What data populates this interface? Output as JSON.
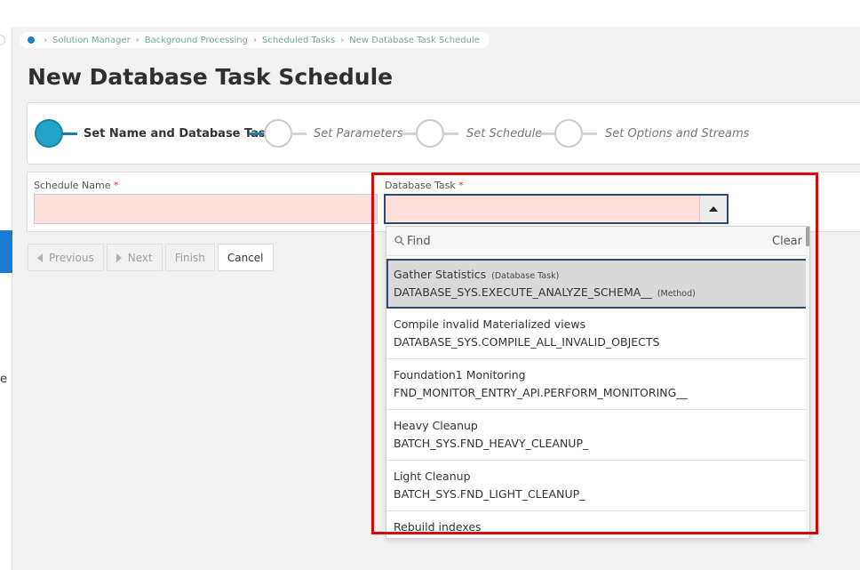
{
  "breadcrumb": {
    "items": [
      "Solution Manager",
      "Background Processing",
      "Scheduled Tasks",
      "New Database Task Schedule"
    ]
  },
  "page": {
    "title": "New Database Task Schedule"
  },
  "stepper": {
    "steps": [
      {
        "label": "Set Name and Database Task",
        "state": "active"
      },
      {
        "label": "Set Parameters",
        "state": "inactive"
      },
      {
        "label": "Set Schedule",
        "state": "inactive"
      },
      {
        "label": "Set Options and Streams",
        "state": "inactive"
      }
    ]
  },
  "form": {
    "schedule_name_label": "Schedule Name",
    "database_task_label": "Database Task",
    "required_marker": "*",
    "schedule_name_value": "",
    "database_task_value": ""
  },
  "buttons": {
    "previous": "Previous",
    "next": "Next",
    "finish": "Finish",
    "cancel": "Cancel"
  },
  "dropdown": {
    "find_placeholder": "Find",
    "clear_label": "Clear",
    "items": [
      {
        "name": "Gather Statistics",
        "name_tag": "(Database Task)",
        "method": "DATABASE_SYS.EXECUTE_ANALYZE_SCHEMA__",
        "method_tag": "(Method)",
        "selected": true
      },
      {
        "name": "Compile invalid Materialized views",
        "method": "DATABASE_SYS.COMPILE_ALL_INVALID_OBJECTS"
      },
      {
        "name": "Foundation1 Monitoring",
        "method": "FND_MONITOR_ENTRY_API.PERFORM_MONITORING__"
      },
      {
        "name": "Heavy Cleanup",
        "method": "BATCH_SYS.FND_HEAVY_CLEANUP_"
      },
      {
        "name": "Light Cleanup",
        "method": "BATCH_SYS.FND_LIGHT_CLEANUP_"
      },
      {
        "name": "Rebuild indexes",
        "method": ""
      }
    ]
  },
  "leftnav": {
    "partial_letter": "e"
  },
  "colors": {
    "accent": "#22a4c8",
    "required_field_bg": "#fde0dc",
    "highlight": "#d20b0b",
    "selection_border": "#2c4a6e"
  },
  "icons": [
    "home-dot-icon",
    "chevron-right-icon",
    "search-icon",
    "caret-up-icon",
    "triangle-left-icon",
    "triangle-right-icon"
  ]
}
